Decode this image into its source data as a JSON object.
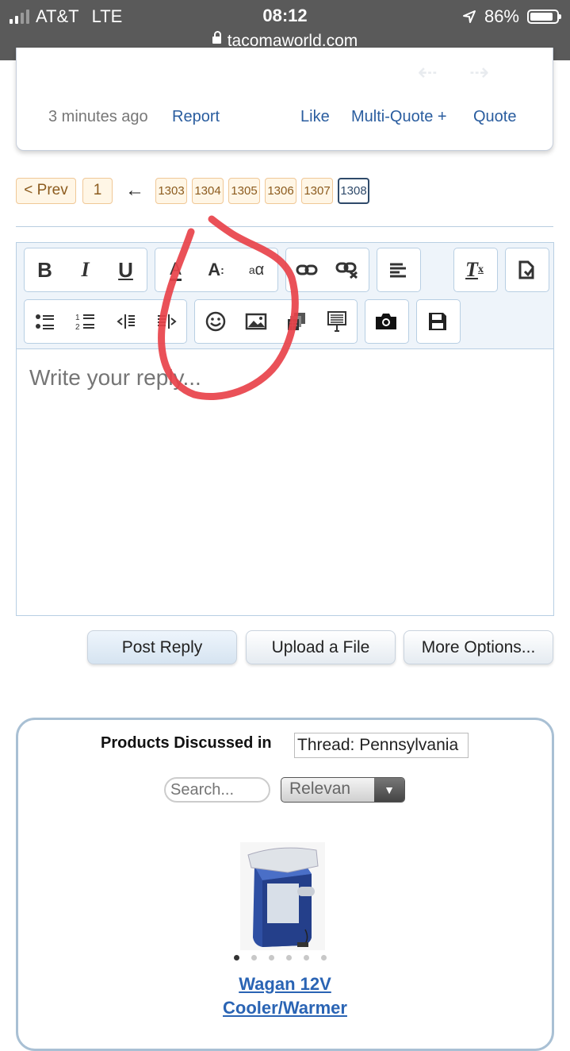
{
  "status_bar": {
    "carrier": "AT&T",
    "network": "LTE",
    "time": "08:12",
    "battery": "86%",
    "battery_level": 0.86,
    "url": "tacomaworld.com",
    "icons": [
      "signal-icon",
      "location-arrow-icon",
      "battery-icon",
      "lock-icon"
    ]
  },
  "post": {
    "time_ago": "3 minutes ago",
    "report": "Report",
    "like": "Like",
    "multi_quote": "Multi-Quote +",
    "quote": "Quote"
  },
  "pagination": {
    "prev": "< Prev",
    "first": "1",
    "arrow": "←",
    "pages": [
      "1303",
      "1304",
      "1305",
      "1306",
      "1307"
    ],
    "current": "1308"
  },
  "editor": {
    "toolbar_row1": [
      {
        "name": "bold-icon",
        "glyph": "B"
      },
      {
        "name": "italic-icon",
        "glyph": "I"
      },
      {
        "name": "underline-icon",
        "glyph": "U"
      },
      {
        "name": "text-color-icon",
        "glyph": "A"
      },
      {
        "name": "font-size-icon",
        "glyph": "A:"
      },
      {
        "name": "font-family-icon",
        "glyph": "ᵃα"
      },
      {
        "name": "link-icon",
        "glyph": "🔗"
      },
      {
        "name": "unlink-icon",
        "glyph": "⛓"
      },
      {
        "name": "align-left-icon",
        "glyph": "≡"
      },
      {
        "name": "remove-format-icon",
        "glyph": "T"
      },
      {
        "name": "bbcode-toggle-icon",
        "glyph": "⟲"
      }
    ],
    "toolbar_row2": [
      {
        "name": "bullet-list-icon",
        "glyph": "•≡"
      },
      {
        "name": "numbered-list-icon",
        "glyph": "1≡"
      },
      {
        "name": "outdent-icon",
        "glyph": "⇤"
      },
      {
        "name": "indent-icon",
        "glyph": "⇥"
      },
      {
        "name": "smiley-icon",
        "glyph": "☺"
      },
      {
        "name": "image-icon",
        "glyph": "▣"
      },
      {
        "name": "media-icon",
        "glyph": "▦"
      },
      {
        "name": "code-block-icon",
        "glyph": "▤"
      },
      {
        "name": "camera-icon",
        "glyph": "📷"
      },
      {
        "name": "save-draft-icon",
        "glyph": "💾"
      }
    ],
    "placeholder": "Write your reply..."
  },
  "buttons": {
    "post_reply": "Post Reply",
    "upload_file": "Upload a File",
    "more_options": "More Options..."
  },
  "products": {
    "heading": "Products Discussed in",
    "thread_value": "Thread: Pennsylvania",
    "search_placeholder": "Search...",
    "sort_value": "Relevan",
    "product_name_line1": "Wagan 12V",
    "product_name_line2": "Cooler/Warmer",
    "carousel_dots": 6,
    "carousel_active": 1
  },
  "colors": {
    "status_bar_bg": "#5a5a5a",
    "link_blue": "#2a5d9f",
    "pager_border": "#f0c897",
    "pager_bg": "#fff6e6",
    "editor_border": "#b8cfe3",
    "annotation_red": "#e8424a"
  }
}
